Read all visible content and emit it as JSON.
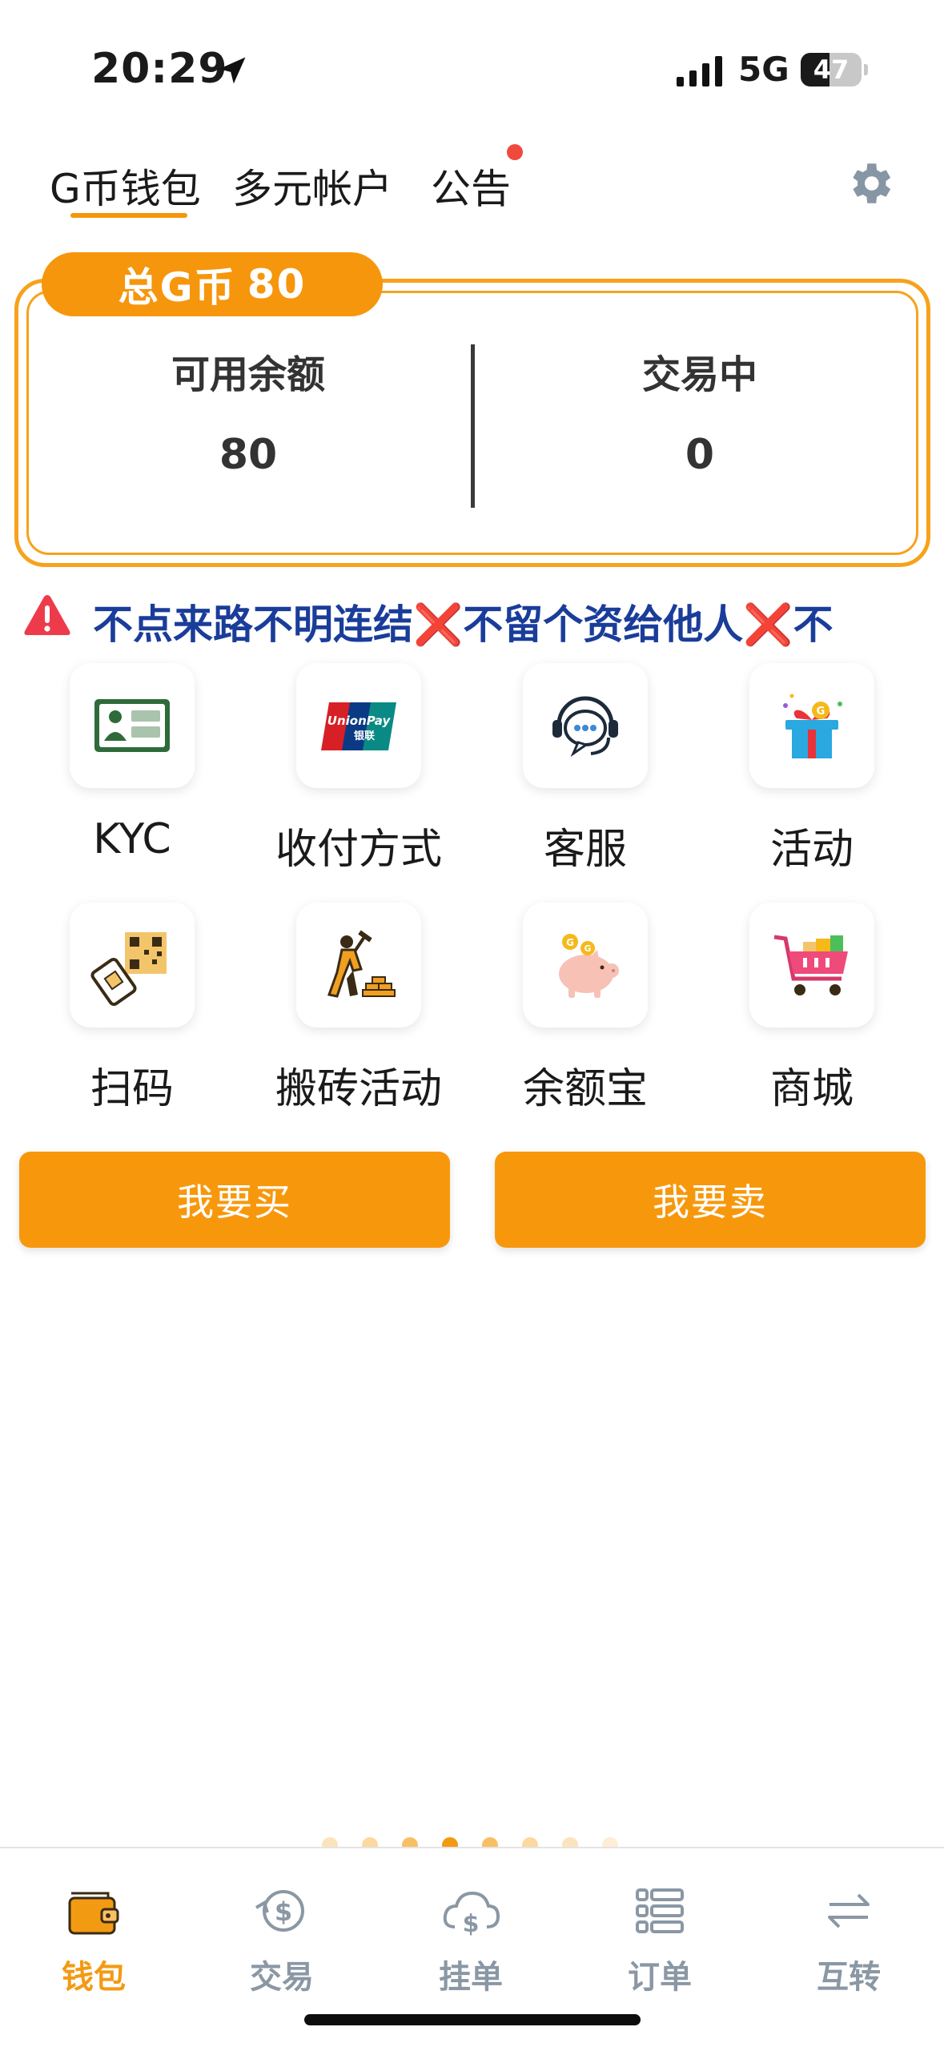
{
  "status_bar": {
    "time": "20:29",
    "network": "5G",
    "battery_level": "47",
    "battery_fraction": 0.47
  },
  "top_tabs": [
    {
      "label": "G币钱包",
      "active": true
    },
    {
      "label": "多元帐户",
      "active": false
    },
    {
      "label": "公告",
      "active": false,
      "has_notification": true
    }
  ],
  "settings_icon": "gear-icon",
  "balance": {
    "total_label": "总G币",
    "total_value": "80",
    "available_label": "可用余额",
    "available_value": "80",
    "trading_label": "交易中",
    "trading_value": "0"
  },
  "marquee": {
    "text": "不点来路不明连结❌不留个资给他人❌不"
  },
  "grid": [
    {
      "label": "KYC",
      "icon": "id-card-icon"
    },
    {
      "label": "收付方式",
      "icon": "unionpay-icon"
    },
    {
      "label": "客服",
      "icon": "customer-service-icon"
    },
    {
      "label": "活动",
      "icon": "gift-icon"
    },
    {
      "label": "扫码",
      "icon": "qr-scan-icon"
    },
    {
      "label": "搬砖活动",
      "icon": "brick-worker-icon"
    },
    {
      "label": "余额宝",
      "icon": "piggy-bank-icon"
    },
    {
      "label": "商城",
      "icon": "shopping-cart-icon"
    }
  ],
  "buttons": {
    "buy": "我要买",
    "sell": "我要卖"
  },
  "bottom_nav": [
    {
      "label": "钱包",
      "icon": "wallet-icon",
      "active": true
    },
    {
      "label": "交易",
      "icon": "exchange-icon",
      "active": false
    },
    {
      "label": "挂单",
      "icon": "cloud-dollar-icon",
      "active": false
    },
    {
      "label": "订单",
      "icon": "list-icon",
      "active": false
    },
    {
      "label": "互转",
      "icon": "transfer-icon",
      "active": false
    }
  ],
  "colors": {
    "accent": "#f7980c",
    "marquee_text": "#1a3d9a",
    "nav_inactive": "#8a97a4",
    "notification": "#f04a3e"
  }
}
